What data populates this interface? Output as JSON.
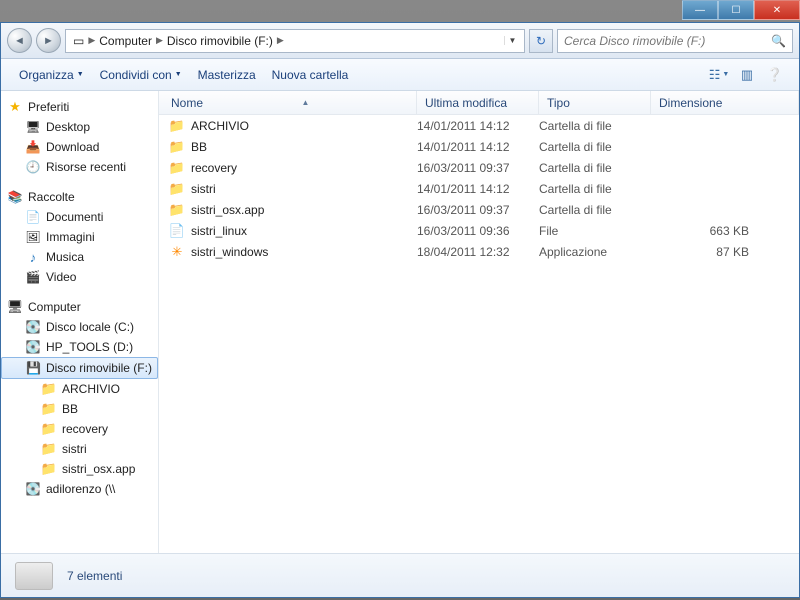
{
  "breadcrumbs": {
    "root_icon": "▬",
    "computer": "Computer",
    "drive": "Disco rimovibile (F:)"
  },
  "search": {
    "placeholder": "Cerca Disco rimovibile (F:)"
  },
  "toolbar": {
    "organize": "Organizza",
    "share": "Condividi con",
    "burn": "Masterizza",
    "newfolder": "Nuova cartella"
  },
  "columns": {
    "name": "Nome",
    "modified": "Ultima modifica",
    "type": "Tipo",
    "size": "Dimensione"
  },
  "sidebar": {
    "favorites": {
      "label": "Preferiti",
      "items": [
        "Desktop",
        "Download",
        "Risorse recenti"
      ]
    },
    "libraries": {
      "label": "Raccolte",
      "items": [
        "Documenti",
        "Immagini",
        "Musica",
        "Video"
      ]
    },
    "computer": {
      "label": "Computer",
      "drives": [
        "Disco locale (C:)",
        "HP_TOOLS (D:)",
        "Disco rimovibile (F:)"
      ],
      "drive_children": [
        "ARCHIVIO",
        "BB",
        "recovery",
        "sistri",
        "sistri_osx.app",
        "adilorenzo (\\\\"
      ]
    }
  },
  "files": [
    {
      "name": "ARCHIVIO",
      "date": "14/01/2011 14:12",
      "type": "Cartella di file",
      "size": "",
      "kind": "folder"
    },
    {
      "name": "BB",
      "date": "14/01/2011 14:12",
      "type": "Cartella di file",
      "size": "",
      "kind": "folder"
    },
    {
      "name": "recovery",
      "date": "16/03/2011 09:37",
      "type": "Cartella di file",
      "size": "",
      "kind": "folder"
    },
    {
      "name": "sistri",
      "date": "14/01/2011 14:12",
      "type": "Cartella di file",
      "size": "",
      "kind": "folder"
    },
    {
      "name": "sistri_osx.app",
      "date": "16/03/2011 09:37",
      "type": "Cartella di file",
      "size": "",
      "kind": "folder"
    },
    {
      "name": "sistri_linux",
      "date": "16/03/2011 09:36",
      "type": "File",
      "size": "663 KB",
      "kind": "file"
    },
    {
      "name": "sistri_windows",
      "date": "18/04/2011 12:32",
      "type": "Applicazione",
      "size": "87 KB",
      "kind": "app"
    }
  ],
  "status": {
    "count": "7 elementi"
  }
}
